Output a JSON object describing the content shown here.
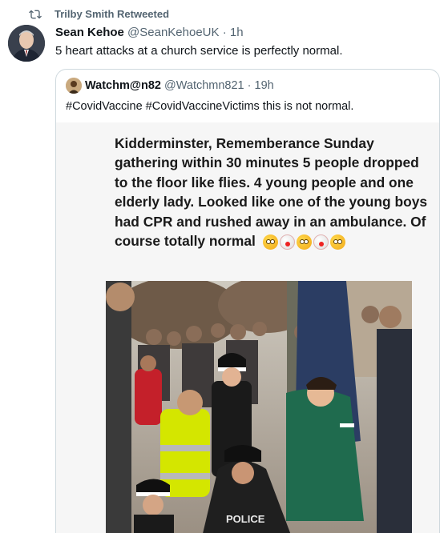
{
  "retweet": {
    "label": "Trilby Smith Retweeted"
  },
  "tweet": {
    "name": "Sean Kehoe",
    "handle": "@SeanKehoeUK",
    "separator": "·",
    "time": "1h",
    "text": "5 heart attacks at a church service is perfectly normal."
  },
  "quote": {
    "name": "Watchm@n82",
    "handle": "@Watchmn821",
    "separator": "·",
    "time": "19h",
    "text": "#CovidVaccine #CovidVaccineVictims this is not normal.",
    "media_text": "Kidderminster, Rememberance Sunday gathering within 30 minutes 5 people dropped to the floor like flies.  4 young people and one elderly lady.  Looked like one of the young boys had CPR and rushed away in an ambulance.  Of course totally normal",
    "emojis": [
      "flushed-face",
      "clown-face",
      "flushed-face",
      "clown-face",
      "flushed-face"
    ],
    "photo_vest_text": "POLICE"
  },
  "colors": {
    "secondary_text": "#536471",
    "primary_text": "#0f1419",
    "border": "#cfd9de",
    "hi_vis": "#d4e600"
  }
}
